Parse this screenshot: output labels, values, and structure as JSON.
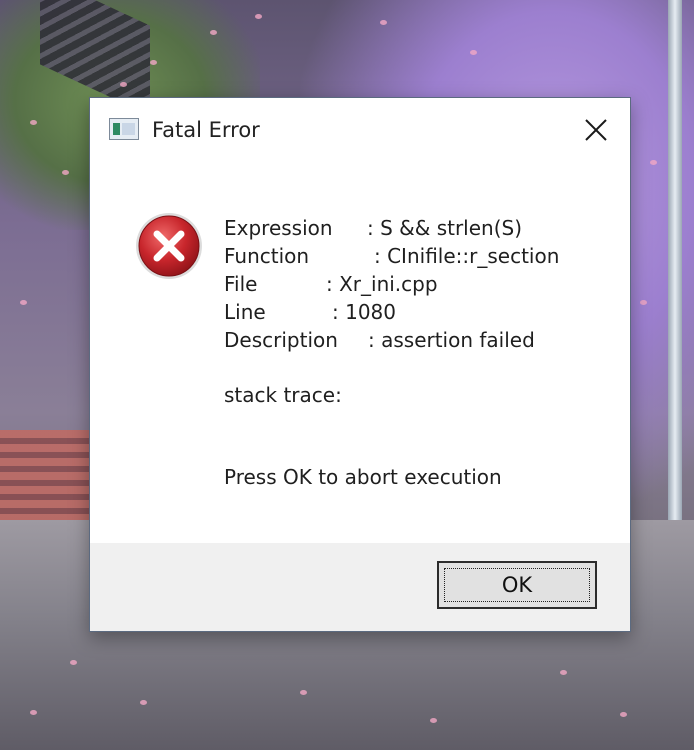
{
  "dialog": {
    "title": "Fatal Error",
    "icons": {
      "app": "window-app-icon",
      "close": "close-icon",
      "error": "error-x-icon"
    },
    "message": [
      {
        "key": "Expression",
        "value": ": S && strlen(S)"
      },
      {
        "key": "Function",
        "value": ": CInifile::r_section"
      },
      {
        "key": "File",
        "value": ": Xr_ini.cpp"
      },
      {
        "key": "Line",
        "value": ": 1080"
      },
      {
        "key": "Description",
        "value": ": assertion failed"
      }
    ],
    "stack_label": "stack trace:",
    "prompt": "Press OK to abort execution",
    "ok_label": "OK"
  },
  "colors": {
    "error_red": "#c8262c",
    "footer_bg": "#f0f0f0"
  }
}
